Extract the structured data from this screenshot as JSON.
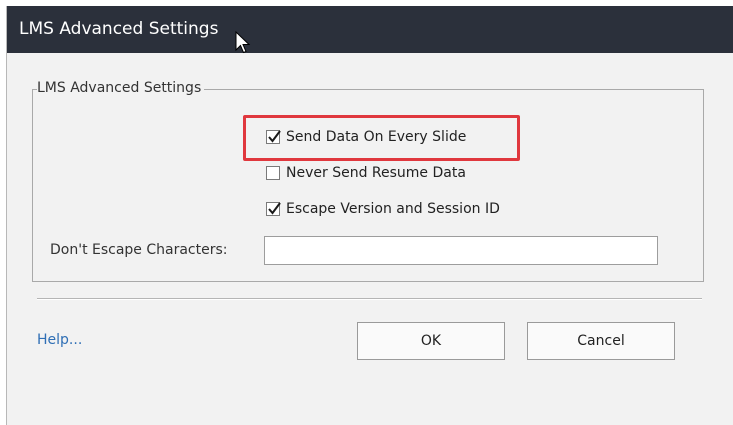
{
  "window": {
    "title": "LMS Advanced Settings"
  },
  "group": {
    "legend": "LMS Advanced Settings",
    "options": [
      {
        "label": "Send Data On Every Slide",
        "checked": true,
        "highlighted": true
      },
      {
        "label": "Never Send Resume Data",
        "checked": false,
        "highlighted": false
      },
      {
        "label": "Escape Version and Session ID",
        "checked": true,
        "highlighted": false
      }
    ],
    "escape_field": {
      "label": "Don't Escape Characters:",
      "value": "",
      "placeholder": ""
    }
  },
  "footer": {
    "help_label": "Help...",
    "ok_label": "OK",
    "cancel_label": "Cancel"
  },
  "colors": {
    "titlebar": "#2b303b",
    "highlight": "#e0383e",
    "link": "#2f6fb5"
  },
  "icons": {
    "cursor": "mouse-pointer-icon",
    "check": "checkmark-icon"
  }
}
